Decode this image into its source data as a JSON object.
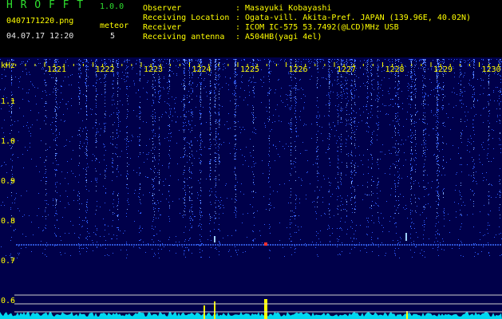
{
  "app": {
    "name": "H R O F F T",
    "version": "1.0.0"
  },
  "file": {
    "name": "0407171220.png",
    "datetime": "04.07.17 12:20"
  },
  "meteor": {
    "label": "meteor",
    "count": "5"
  },
  "station": {
    "observer_label": "Observer",
    "observer_value": ": Masayuki Kobayashi",
    "location_label": "Receiving Location",
    "location_value": ": Ogata-vill. Akita-Pref. JAPAN (139.96E, 40.02N)",
    "receiver_label": "Receiver",
    "receiver_value": ": ICOM IC-575 53.7492(@LCD)MHz USB",
    "antenna_label": "Receiving antenna",
    "antenna_value": ": A504HB(yagi 4el)"
  },
  "axis": {
    "unit": "kHz",
    "y_labels": [
      "1.1",
      "1.0",
      "0.9",
      "0.8",
      "0.7",
      "0.6"
    ],
    "x_labels": [
      "1221",
      "1222",
      "1223",
      "1224",
      "1225",
      "1226",
      "1227",
      "1228",
      "1229",
      "1230"
    ]
  },
  "colors": {
    "background": "#000000",
    "plot_bg": "#00004a",
    "title_green": "#2fe02f",
    "text_yellow": "#ffff00",
    "echo_yellow": "#ffff00",
    "spectrum_cyan": "#00e0ff"
  }
}
